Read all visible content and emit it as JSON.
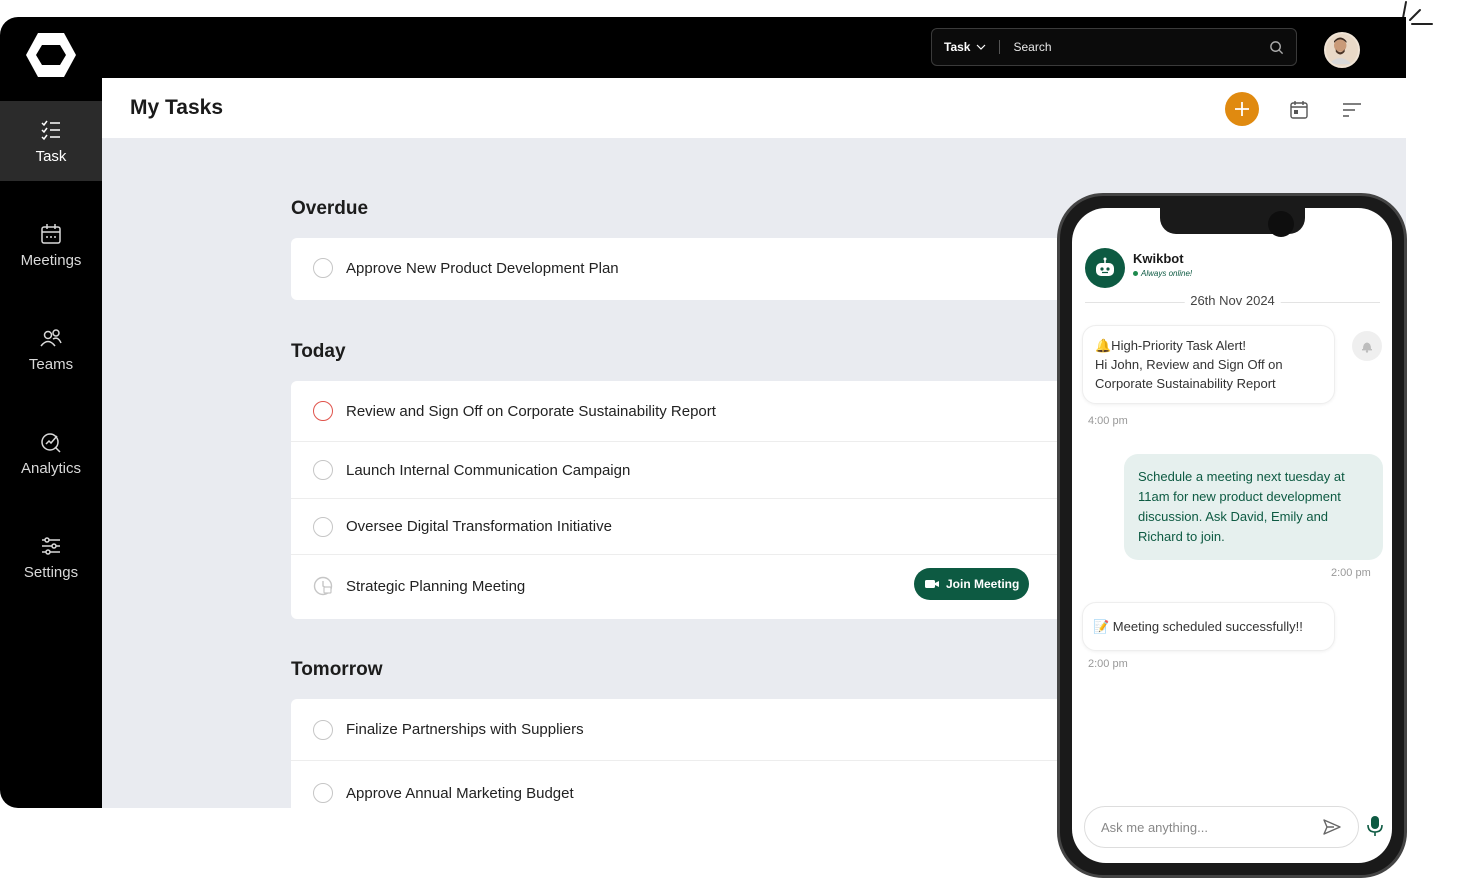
{
  "topbar": {
    "search_type": "Task",
    "search_placeholder": "Search"
  },
  "sidebar": {
    "items": [
      {
        "label": "Task",
        "icon": "task-list-icon",
        "active": true
      },
      {
        "label": "Meetings",
        "icon": "calendar-icon",
        "active": false
      },
      {
        "label": "Teams",
        "icon": "people-icon",
        "active": false
      },
      {
        "label": "Analytics",
        "icon": "analytics-icon",
        "active": false
      },
      {
        "label": "Settings",
        "icon": "sliders-icon",
        "active": false
      }
    ]
  },
  "main": {
    "title": "My Tasks",
    "sections": {
      "overdue": {
        "title": "Overdue",
        "tasks": [
          "Approve New Product Development Plan"
        ]
      },
      "today": {
        "title": "Today",
        "tasks": [
          "Review and Sign Off on Corporate Sustainability Report",
          "Launch Internal Communication Campaign",
          "Oversee Digital Transformation Initiative",
          "Strategic Planning Meeting"
        ],
        "join_label": "Join Meeting"
      },
      "tomorrow": {
        "title": "Tomorrow",
        "tasks": [
          "Finalize Partnerships with Suppliers",
          "Approve Annual Marketing Budget"
        ]
      }
    }
  },
  "chat": {
    "bot_name": "Kwikbot",
    "bot_status": "Always online!",
    "date": "26th Nov 2024",
    "messages": [
      {
        "line1": "🔔High-Priority Task Alert!",
        "line2": "Hi John, Review and Sign Off on",
        "line3": "Corporate Sustainability Report",
        "time": "4:00 pm"
      },
      {
        "text": "Schedule a meeting next tuesday at 11am for new product development discussion. Ask David, Emily and Richard to join.",
        "time": "2:00 pm"
      },
      {
        "text": "📝 Meeting scheduled successfully!!",
        "time": "2:00 pm"
      }
    ],
    "input_placeholder": "Ask me anything..."
  },
  "colors": {
    "accent": "#e08a10",
    "brand_green": "#0d5a42",
    "overdue_red": "#e0534b"
  }
}
